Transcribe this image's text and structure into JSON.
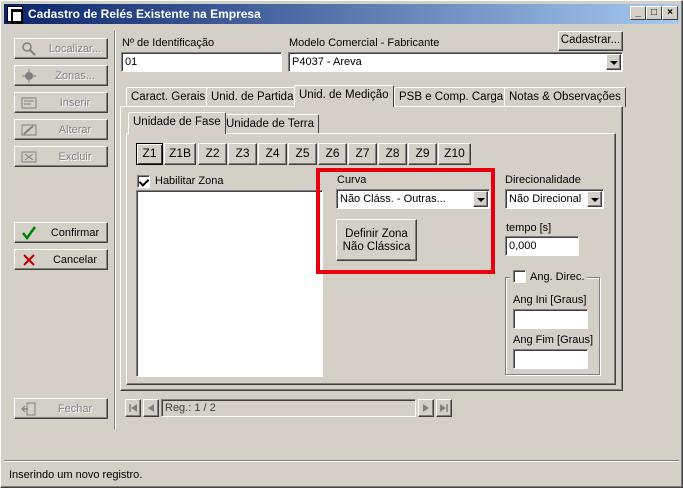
{
  "window": {
    "title": "Cadastro de Relés Existente na Empresa",
    "minimize": "_",
    "maximize": "□",
    "close": "×"
  },
  "sidebar": {
    "localizar": "Localizar...",
    "zonas": "Zonas...",
    "inserir": "Inserir",
    "alterar": "Alterar",
    "excluir": "Excluir",
    "confirmar": "Confirmar",
    "cancelar": "Cancelar",
    "fechar": "Fechar"
  },
  "form": {
    "id_label": "Nº de Identificação",
    "id_value": "01",
    "modelo_label": "Modelo Comercial - Fabricante",
    "modelo_value": "P4037  -  Areva",
    "cadastrar": "Cadastrar..."
  },
  "tabs": [
    "Caract. Gerais",
    "Unid. de Partida",
    "Unid. de Medição",
    "PSB e Comp. Carga",
    "Notas & Observações"
  ],
  "subtabs": [
    "Unidade de Fase",
    "Unidade de Terra"
  ],
  "zones": [
    "Z1",
    "Z1B",
    "Z2",
    "Z3",
    "Z4",
    "Z5",
    "Z6",
    "Z7",
    "Z8",
    "Z9",
    "Z10"
  ],
  "zone_panel": {
    "habilitar": "Habilitar Zona",
    "curva_label": "Curva",
    "curva_value": "Não Cláss. - Outras...",
    "definir_line1": "Definir Zona",
    "definir_line2": "Não Clássica",
    "direc_label": "Direcionalidade",
    "direc_value": "Não Direcional",
    "tempo_label": "tempo [s]",
    "tempo_value": "0,000",
    "ang_direc": "Ang. Direc.",
    "ang_ini": "Ang Ini [Graus]",
    "ang_fim": "Ang Fim [Graus]"
  },
  "navigator": {
    "record": "Reg.: 1 / 2"
  },
  "status": {
    "text": "Inserindo um novo registro."
  },
  "colors": {
    "highlight": "#e8000f",
    "title_start": "#0a246a",
    "title_end": "#a6caf0"
  }
}
